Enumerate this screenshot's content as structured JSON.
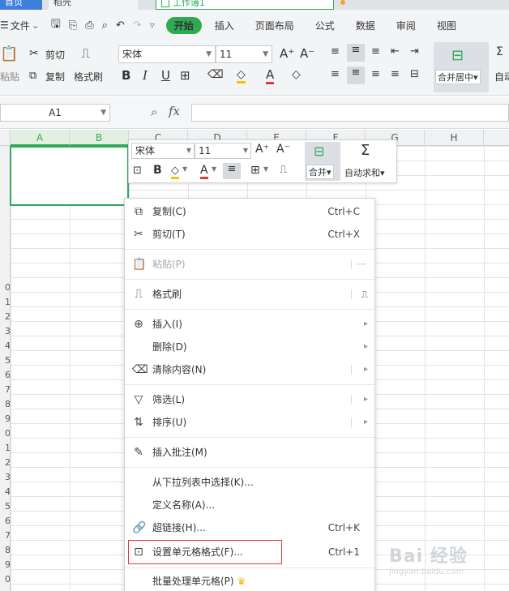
{
  "tabs": {
    "home": "首页",
    "draft": "稻壳",
    "book": "工作簿1"
  },
  "menu": {
    "file": "文件",
    "start": "开始",
    "insert": "插入",
    "layout": "页面布局",
    "formula": "公式",
    "data": "数据",
    "review": "审阅",
    "view": "视图"
  },
  "ribbon": {
    "paste": "粘贴",
    "cut": "剪切",
    "copy": "复制",
    "format_painter": "格式刷",
    "font_name": "宋体",
    "font_size": "11",
    "merge_center": "合并居中",
    "auto_sum_partial": "自动"
  },
  "formula_bar": {
    "cell_ref": "A1",
    "fx": "fx"
  },
  "columns": [
    "A",
    "B",
    "C",
    "D",
    "E",
    "F",
    "G",
    "H"
  ],
  "rows": [
    "0",
    "1",
    "2",
    "3",
    "4",
    "5",
    "6",
    "7",
    "8",
    "9",
    "0",
    "1",
    "2",
    "3",
    "4",
    "5",
    "6",
    "7",
    "8",
    "9",
    "0"
  ],
  "mini_toolbar": {
    "font_name": "宋体",
    "font_size": "11",
    "merge": "合并",
    "auto_sum": "自动求和"
  },
  "context_menu": {
    "copy": {
      "label": "复制(C)",
      "shortcut": "Ctrl+C"
    },
    "cut": {
      "label": "剪切(T)",
      "shortcut": "Ctrl+X"
    },
    "paste": {
      "label": "粘贴(P)",
      "more": "···"
    },
    "format_painter": {
      "label": "格式刷"
    },
    "insert": {
      "label": "插入(I)"
    },
    "delete": {
      "label": "删除(D)"
    },
    "clear": {
      "label": "清除内容(N)"
    },
    "filter": {
      "label": "筛选(L)"
    },
    "sort": {
      "label": "排序(U)"
    },
    "insert_comment": {
      "label": "插入批注(M)"
    },
    "pick_list": {
      "label": "从下拉列表中选择(K)..."
    },
    "define_name": {
      "label": "定义名称(A)..."
    },
    "hyperlink": {
      "label": "超链接(H)...",
      "shortcut": "Ctrl+K"
    },
    "format_cells": {
      "label": "设置单元格格式(F)...",
      "shortcut": "Ctrl+1"
    },
    "batch": {
      "label": "批量处理单元格(P)"
    }
  },
  "watermark": {
    "main": "Bai 经验",
    "sub": "jingyan.baidu.com"
  },
  "colors": {
    "accent": "#2eaa5a",
    "highlight_border": "#e53935",
    "crown": "#f5b400"
  }
}
